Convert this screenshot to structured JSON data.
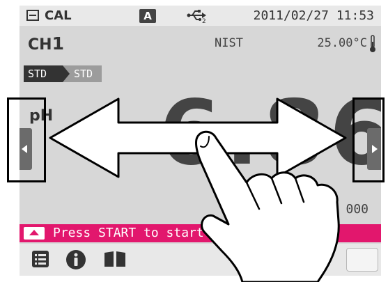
{
  "statusbar": {
    "mode_icon": "calibration-mode-icon",
    "mode_label": "CAL",
    "auto_badge": "A",
    "usb_icon": "usb-icon",
    "usb_sub": "2",
    "datetime": "2011/02/27 11:53"
  },
  "channel": {
    "prefix": "CH",
    "number": "1"
  },
  "buffer_standard": "NIST",
  "temperature": "25.00°C",
  "thermometer_icon": "thermometer-icon",
  "std_steps": [
    "STD",
    "STD"
  ],
  "measurement": {
    "parameter": "pH",
    "value": "6.861",
    "secondary_value": "000"
  },
  "nav": {
    "prev_icon": "chevron-left-icon",
    "next_icon": "chevron-right-icon"
  },
  "message": {
    "icon": "start-triangle-icon",
    "text": "Press START to start ca"
  },
  "bottombar": {
    "icons": [
      "list-icon",
      "info-icon",
      "book-icon"
    ]
  },
  "overlay": {
    "gesture": "swipe-left-right",
    "arrow_icon": "double-arrow-icon",
    "hand_icon": "pointing-hand-icon"
  },
  "colors": {
    "accent": "#e2176d",
    "screen_bg": "#d7d7d7",
    "frame": "#000000"
  }
}
